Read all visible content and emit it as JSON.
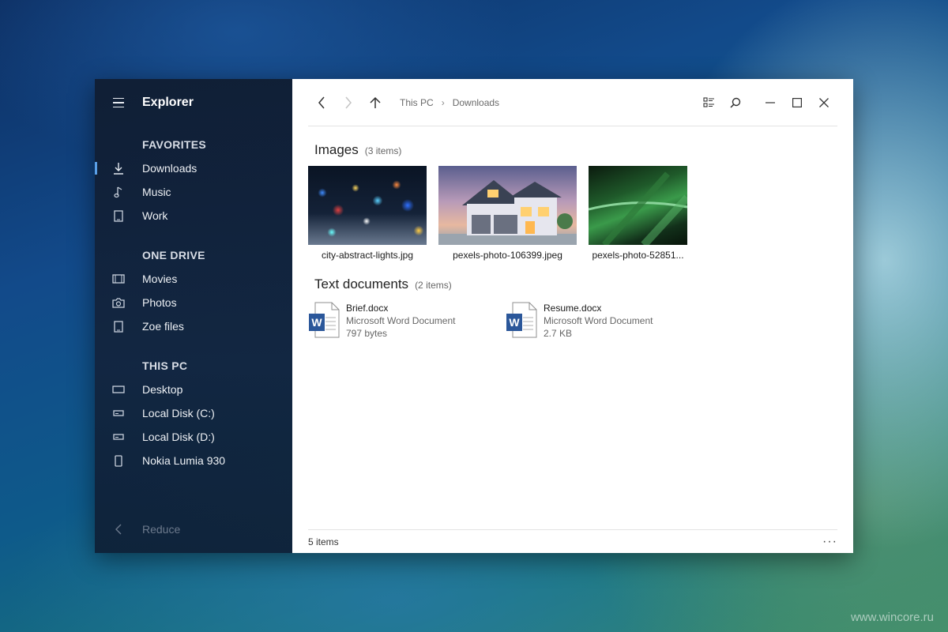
{
  "app": {
    "title": "Explorer"
  },
  "sidebar": {
    "favorites_heading": "FAVORITES",
    "favorites": [
      {
        "label": "Downloads",
        "icon": "download-icon",
        "active": true
      },
      {
        "label": "Music",
        "icon": "music-icon"
      },
      {
        "label": "Work",
        "icon": "tablet-icon"
      }
    ],
    "onedrive_heading": "ONE DRIVE",
    "onedrive": [
      {
        "label": "Movies",
        "icon": "film-icon"
      },
      {
        "label": "Photos",
        "icon": "camera-icon"
      },
      {
        "label": "Zoe files",
        "icon": "tablet-icon"
      }
    ],
    "thispc_heading": "THIS PC",
    "thispc": [
      {
        "label": "Desktop",
        "icon": "desktop-icon"
      },
      {
        "label": "Local Disk (C:)",
        "icon": "drive-icon"
      },
      {
        "label": "Local Disk (D:)",
        "icon": "drive-icon"
      },
      {
        "label": "Nokia Lumia 930",
        "icon": "phone-icon"
      }
    ],
    "reduce_label": "Reduce"
  },
  "breadcrumb": {
    "root": "This PC",
    "current": "Downloads"
  },
  "groups": {
    "images": {
      "name": "Images",
      "count": "(3 items)",
      "items": [
        {
          "name": "city-abstract-lights.jpg"
        },
        {
          "name": "pexels-photo-106399.jpeg"
        },
        {
          "name": "pexels-photo-52851..."
        }
      ]
    },
    "docs": {
      "name": "Text documents",
      "count": "(2 items)",
      "items": [
        {
          "name": "Brief.docx",
          "type": "Microsoft Word Document",
          "size": "797 bytes"
        },
        {
          "name": "Resume.docx",
          "type": "Microsoft Word Document",
          "size": "2.7 KB"
        }
      ]
    }
  },
  "status": {
    "items_count": "5 items",
    "more": "···"
  },
  "watermark": "www.wincore.ru",
  "colors": {
    "accent": "#5aa0e8",
    "word_blue": "#2b579a"
  }
}
